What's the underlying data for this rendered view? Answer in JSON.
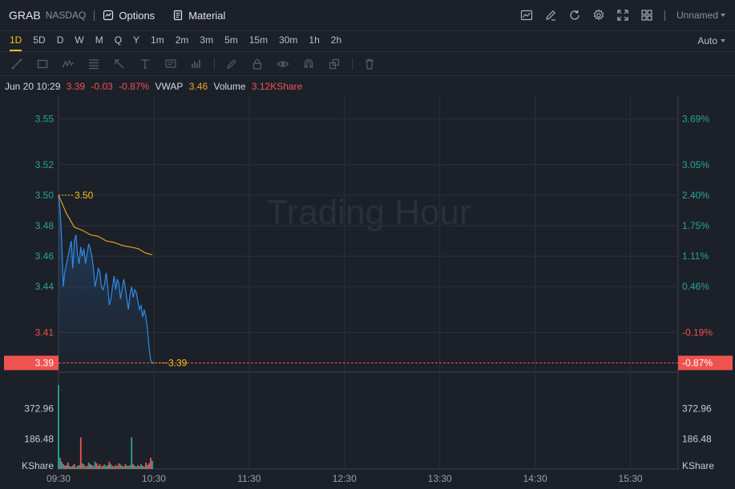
{
  "header": {
    "symbol": "GRAB",
    "exchange": "NASDAQ",
    "options_label": "Options",
    "material_label": "Material",
    "layout_name": "Unnamed"
  },
  "periods": [
    "1D",
    "5D",
    "D",
    "W",
    "M",
    "Q",
    "Y",
    "1m",
    "2m",
    "3m",
    "5m",
    "15m",
    "30m",
    "1h",
    "2h"
  ],
  "active_period": "1D",
  "scale_mode": "Auto",
  "info": {
    "datetime": "Jun 20 10:29",
    "price": "3.39",
    "change": "-0.03",
    "change_pct": "-0.87%",
    "vwap_label": "VWAP",
    "vwap_value": "3.46",
    "volume_label": "Volume",
    "volume_value": "3.12KShare"
  },
  "watermark": "Trading Hour",
  "colors": {
    "price_line": "#2f8be6",
    "vwap_line": "#f5a623",
    "up": "#26a69a",
    "down": "#ef5350",
    "accent": "#f5c518",
    "tag_bg": "#ef5350"
  },
  "chart_data": {
    "type": "line",
    "x_ticks": [
      "09:30",
      "10:30",
      "11:30",
      "12:30",
      "13:30",
      "14:30",
      "15:30"
    ],
    "y_ticks_left": [
      "3.55",
      "3.52",
      "3.50",
      "3.48",
      "3.46",
      "3.44",
      "3.41"
    ],
    "y_ticks_right": [
      "3.69%",
      "3.05%",
      "2.40%",
      "1.75%",
      "1.11%",
      "0.46%",
      "-0.19%"
    ],
    "prev_close_ticks_color_up": "#26a69a",
    "prev_close_ticks_color_down": "#ef5350",
    "ylim": [
      3.385,
      3.565
    ],
    "current_price": 3.39,
    "current_price_label": "3.39",
    "current_pct_label": "-0.87%",
    "high_label": "3.50",
    "high_value": 3.5,
    "low_label": "3.39",
    "x_minutes_range": [
      0,
      390
    ],
    "price_series": {
      "minutes": [
        0,
        1,
        2,
        3,
        4,
        5,
        6,
        7,
        8,
        9,
        10,
        11,
        12,
        13,
        14,
        15,
        16,
        17,
        18,
        19,
        20,
        21,
        22,
        23,
        24,
        25,
        26,
        27,
        28,
        29,
        30,
        31,
        32,
        33,
        34,
        35,
        36,
        37,
        38,
        39,
        40,
        41,
        42,
        43,
        44,
        45,
        46,
        47,
        48,
        49,
        50,
        51,
        52,
        53,
        54,
        55,
        56,
        57,
        58,
        59
      ],
      "values": [
        3.5,
        3.49,
        3.47,
        3.44,
        3.45,
        3.455,
        3.46,
        3.465,
        3.47,
        3.452,
        3.47,
        3.474,
        3.46,
        3.455,
        3.466,
        3.46,
        3.465,
        3.455,
        3.462,
        3.468,
        3.465,
        3.46,
        3.452,
        3.44,
        3.445,
        3.452,
        3.45,
        3.44,
        3.438,
        3.442,
        3.449,
        3.44,
        3.428,
        3.432,
        3.44,
        3.447,
        3.438,
        3.445,
        3.442,
        3.432,
        3.438,
        3.445,
        3.44,
        3.432,
        3.425,
        3.435,
        3.44,
        3.433,
        3.438,
        3.436,
        3.43,
        3.425,
        3.428,
        3.42,
        3.425,
        3.42,
        3.412,
        3.4,
        3.392,
        3.39
      ]
    },
    "vwap_series": {
      "minutes": [
        0,
        5,
        10,
        15,
        20,
        25,
        30,
        35,
        40,
        45,
        50,
        55,
        59
      ],
      "values": [
        3.5,
        3.488,
        3.479,
        3.477,
        3.474,
        3.473,
        3.47,
        3.469,
        3.467,
        3.466,
        3.465,
        3.462,
        3.461
      ]
    },
    "volume_ticks_left": [
      "372.96",
      "186.48",
      "KShare"
    ],
    "volume_ticks_right": [
      "372.96",
      "186.48",
      "KShare"
    ],
    "volume_max": 559.44,
    "volume_series": [
      {
        "m": 0,
        "v": 520,
        "up": true
      },
      {
        "m": 1,
        "v": 70,
        "up": true
      },
      {
        "m": 2,
        "v": 45,
        "up": false
      },
      {
        "m": 3,
        "v": 30,
        "up": true
      },
      {
        "m": 4,
        "v": 20,
        "up": false
      },
      {
        "m": 5,
        "v": 25,
        "up": true
      },
      {
        "m": 6,
        "v": 40,
        "up": false
      },
      {
        "m": 7,
        "v": 18,
        "up": true
      },
      {
        "m": 8,
        "v": 15,
        "up": false
      },
      {
        "m": 9,
        "v": 22,
        "up": true
      },
      {
        "m": 10,
        "v": 30,
        "up": false
      },
      {
        "m": 11,
        "v": 12,
        "up": true
      },
      {
        "m": 12,
        "v": 20,
        "up": false
      },
      {
        "m": 13,
        "v": 25,
        "up": true
      },
      {
        "m": 14,
        "v": 195,
        "up": false
      },
      {
        "m": 15,
        "v": 35,
        "up": true
      },
      {
        "m": 16,
        "v": 28,
        "up": false
      },
      {
        "m": 17,
        "v": 15,
        "up": true
      },
      {
        "m": 18,
        "v": 20,
        "up": false
      },
      {
        "m": 19,
        "v": 40,
        "up": true
      },
      {
        "m": 20,
        "v": 30,
        "up": false
      },
      {
        "m": 21,
        "v": 25,
        "up": true
      },
      {
        "m": 22,
        "v": 18,
        "up": false
      },
      {
        "m": 23,
        "v": 45,
        "up": true
      },
      {
        "m": 24,
        "v": 35,
        "up": false
      },
      {
        "m": 25,
        "v": 20,
        "up": true
      },
      {
        "m": 26,
        "v": 30,
        "up": false
      },
      {
        "m": 27,
        "v": 15,
        "up": true
      },
      {
        "m": 28,
        "v": 22,
        "up": false
      },
      {
        "m": 29,
        "v": 28,
        "up": true
      },
      {
        "m": 30,
        "v": 18,
        "up": false
      },
      {
        "m": 31,
        "v": 25,
        "up": true
      },
      {
        "m": 32,
        "v": 45,
        "up": false
      },
      {
        "m": 33,
        "v": 30,
        "up": true
      },
      {
        "m": 34,
        "v": 20,
        "up": false
      },
      {
        "m": 35,
        "v": 15,
        "up": true
      },
      {
        "m": 36,
        "v": 25,
        "up": false
      },
      {
        "m": 37,
        "v": 18,
        "up": true
      },
      {
        "m": 38,
        "v": 35,
        "up": false
      },
      {
        "m": 39,
        "v": 28,
        "up": true
      },
      {
        "m": 40,
        "v": 20,
        "up": false
      },
      {
        "m": 41,
        "v": 15,
        "up": true
      },
      {
        "m": 42,
        "v": 30,
        "up": false
      },
      {
        "m": 43,
        "v": 22,
        "up": true
      },
      {
        "m": 44,
        "v": 18,
        "up": false
      },
      {
        "m": 45,
        "v": 25,
        "up": true
      },
      {
        "m": 46,
        "v": 195,
        "up": true
      },
      {
        "m": 47,
        "v": 30,
        "up": false
      },
      {
        "m": 48,
        "v": 20,
        "up": true
      },
      {
        "m": 49,
        "v": 15,
        "up": false
      },
      {
        "m": 50,
        "v": 25,
        "up": true
      },
      {
        "m": 51,
        "v": 18,
        "up": false
      },
      {
        "m": 52,
        "v": 30,
        "up": true
      },
      {
        "m": 53,
        "v": 20,
        "up": false
      },
      {
        "m": 54,
        "v": 15,
        "up": true
      },
      {
        "m": 55,
        "v": 40,
        "up": false
      },
      {
        "m": 56,
        "v": 25,
        "up": true
      },
      {
        "m": 57,
        "v": 35,
        "up": false
      },
      {
        "m": 58,
        "v": 70,
        "up": false
      },
      {
        "m": 59,
        "v": 50,
        "up": true
      }
    ]
  }
}
